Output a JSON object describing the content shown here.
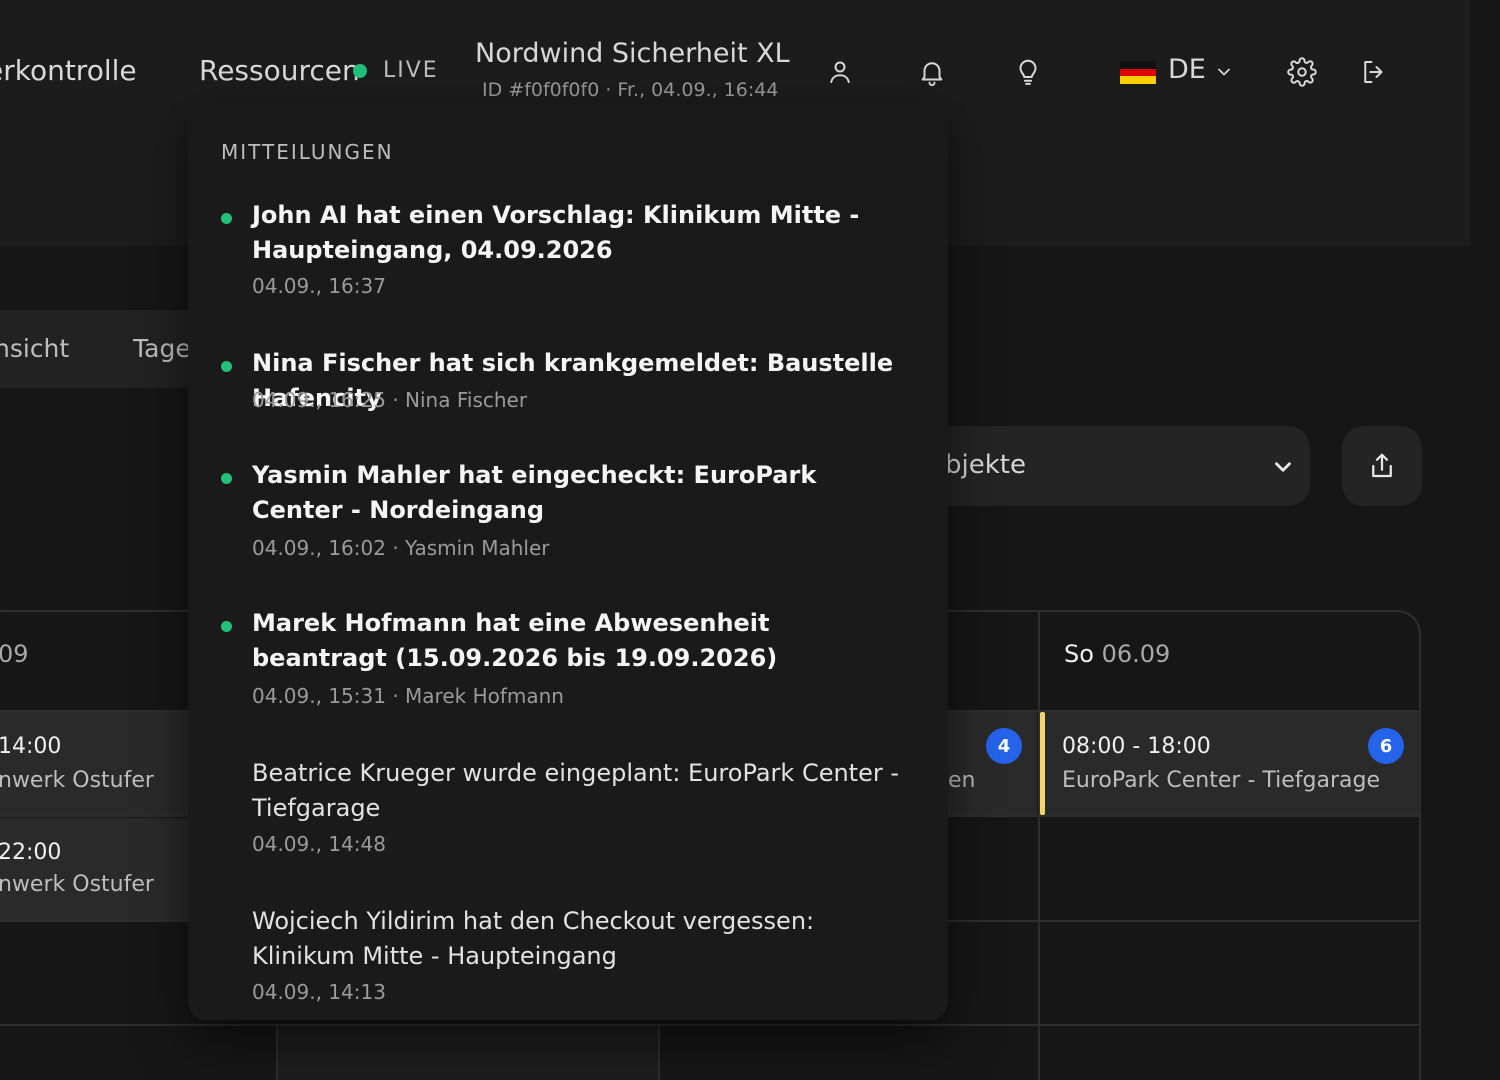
{
  "header": {
    "nav": {
      "zugriffskontrolle": "erkontrolle",
      "ressourcen": "Ressourcen"
    },
    "live_label": "LIVE",
    "company": {
      "name": "Nordwind Sicherheit XL",
      "meta": "ID #f0f0f0f0 · Fr., 04.09., 16:44"
    },
    "language": {
      "code": "DE"
    },
    "icons": {
      "profile": "user-icon",
      "notifications": "bell-icon",
      "tips": "lightbulb-icon",
      "settings": "gear-icon",
      "logout": "logout-icon"
    }
  },
  "view_tabs": {
    "tab1": "nsicht",
    "tab2": "Tage"
  },
  "filters": {
    "object_select": "bjekte"
  },
  "calendar": {
    "days": {
      "left": {
        "date": "09"
      },
      "sunday": {
        "name": "So",
        "date": "06.09"
      }
    },
    "left_shifts": [
      {
        "time": "14:00",
        "location": "nwerk Ostufer"
      },
      {
        "time": "22:00",
        "location": "nwerk Ostufer"
      }
    ],
    "mid_shift": {
      "location": "en",
      "count": "4"
    },
    "sunday_shift": {
      "time": "08:00 - 18:00",
      "location": "EuroPark Center - Tiefgarage",
      "count": "6"
    }
  },
  "notifications": {
    "heading": "MITTEILUNGEN",
    "items": [
      {
        "title": "John AI hat einen Vorschlag: Klinikum Mitte - Haupteingang, 04.09.2026",
        "meta": "04.09., 16:37",
        "unread": true
      },
      {
        "title": "Nina Fischer hat sich krankgemeldet: Baustelle Hafencity",
        "meta": "04.09., 16:25 · Nina Fischer",
        "unread": true
      },
      {
        "title": "Yasmin Mahler hat eingecheckt: EuroPark Center - Nordeingang",
        "meta": "04.09., 16:02 · Yasmin Mahler",
        "unread": true
      },
      {
        "title": "Marek Hofmann hat eine Abwesenheit beantragt (15.09.2026 bis 19.09.2026)",
        "meta": "04.09., 15:31 · Marek Hofmann",
        "unread": true
      },
      {
        "title": "Beatrice Krueger wurde eingeplant: EuroPark Center - Tiefgarage",
        "meta": "04.09., 14:48",
        "unread": false
      },
      {
        "title": "Wojciech Yildirim hat den Checkout vergessen: Klinikum Mitte - Haupteingang",
        "meta": "04.09., 14:13",
        "unread": false
      }
    ]
  },
  "colors": {
    "live": "#22c07a",
    "badge": "#2563eb",
    "accent": "#f2d56b",
    "unread_dot": "#22c07a"
  }
}
